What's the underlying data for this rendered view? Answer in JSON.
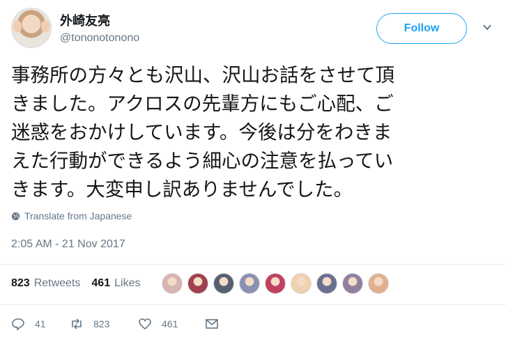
{
  "user": {
    "display_name": "外崎友亮",
    "handle": "@tononotonono",
    "follow_label": "Follow"
  },
  "tweet": {
    "lines": [
      "事務所の方々とも沢山、沢山お話をさせて頂",
      "きました。アクロスの先輩方にもご心配、ご",
      "迷惑をおかけしています。今後は分をわきま",
      "えた行動ができるよう細心の注意を払ってい",
      "きます。大変申し訳ありませんでした。"
    ],
    "translate_label": "Translate from Japanese",
    "timestamp": "2:05 AM - 21 Nov 2017"
  },
  "stats": {
    "retweets_count": "823",
    "retweets_label": "Retweets",
    "likes_count": "461",
    "likes_label": "Likes",
    "liker_avatars": [
      "#d8b4b0",
      "#a04050",
      "#556070",
      "#8a90b0",
      "#c04060",
      "#f0d0b0",
      "#6a7090",
      "#9080a0",
      "#e0b090"
    ]
  },
  "actions": {
    "reply_count": "41",
    "retweet_count": "823",
    "like_count": "461"
  }
}
